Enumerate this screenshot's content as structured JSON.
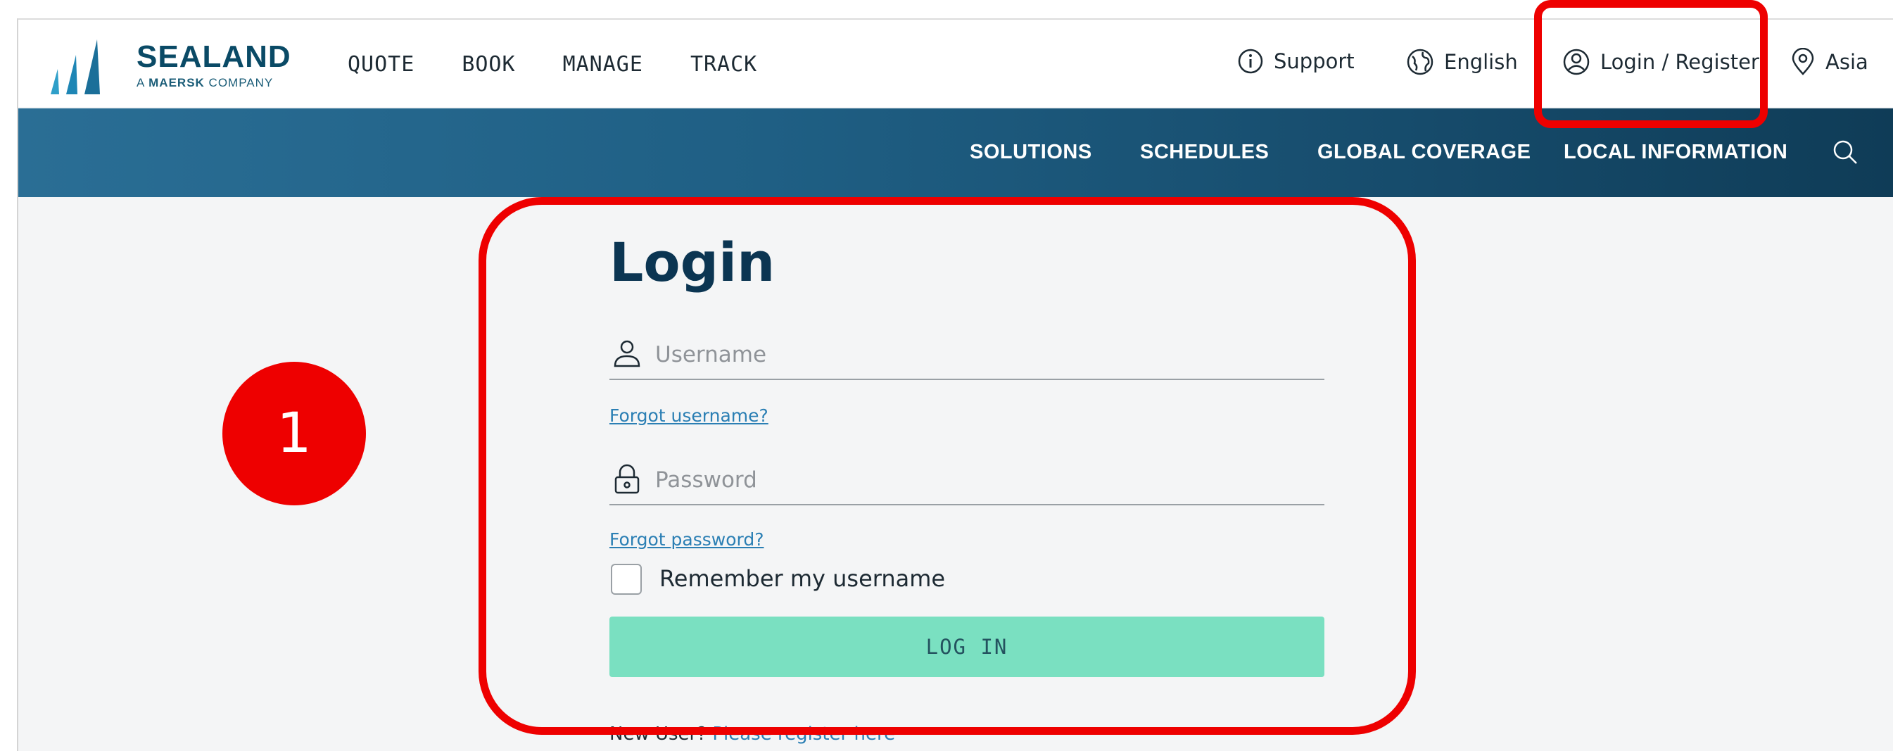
{
  "brand": {
    "name": "SEALAND",
    "tagline_prefix": "A",
    "tagline_brand": "MAERSK",
    "tagline_suffix": "COMPANY",
    "color": "#0a4a66"
  },
  "main_nav": [
    "QUOTE",
    "BOOK",
    "MANAGE",
    "TRACK"
  ],
  "utility_nav": {
    "support": "Support",
    "language": "English",
    "login": "Login / Register",
    "region": "Asia"
  },
  "sub_nav": {
    "items": [
      "SOLUTIONS",
      "SCHEDULES",
      "GLOBAL COVERAGE",
      "LOCAL INFORMATION"
    ],
    "search_icon": "search-icon"
  },
  "login_form": {
    "title": "Login",
    "username_placeholder": "Username",
    "forgot_username": "Forgot username?",
    "password_placeholder": "Password",
    "forgot_password": "Forgot password?",
    "remember_label": "Remember my username",
    "remember_checked": false,
    "submit_label": "LOG IN",
    "new_user_text": "New User?",
    "register_link": "Please register here"
  },
  "annotation": {
    "step_number": "1",
    "highlight_color": "#ee0000"
  },
  "colors": {
    "subnav_gradient_start": "#2a6e95",
    "subnav_gradient_end": "#0f3c57",
    "button": "#7ae0c1",
    "link": "#2b7fb4",
    "title": "#0b3552"
  }
}
